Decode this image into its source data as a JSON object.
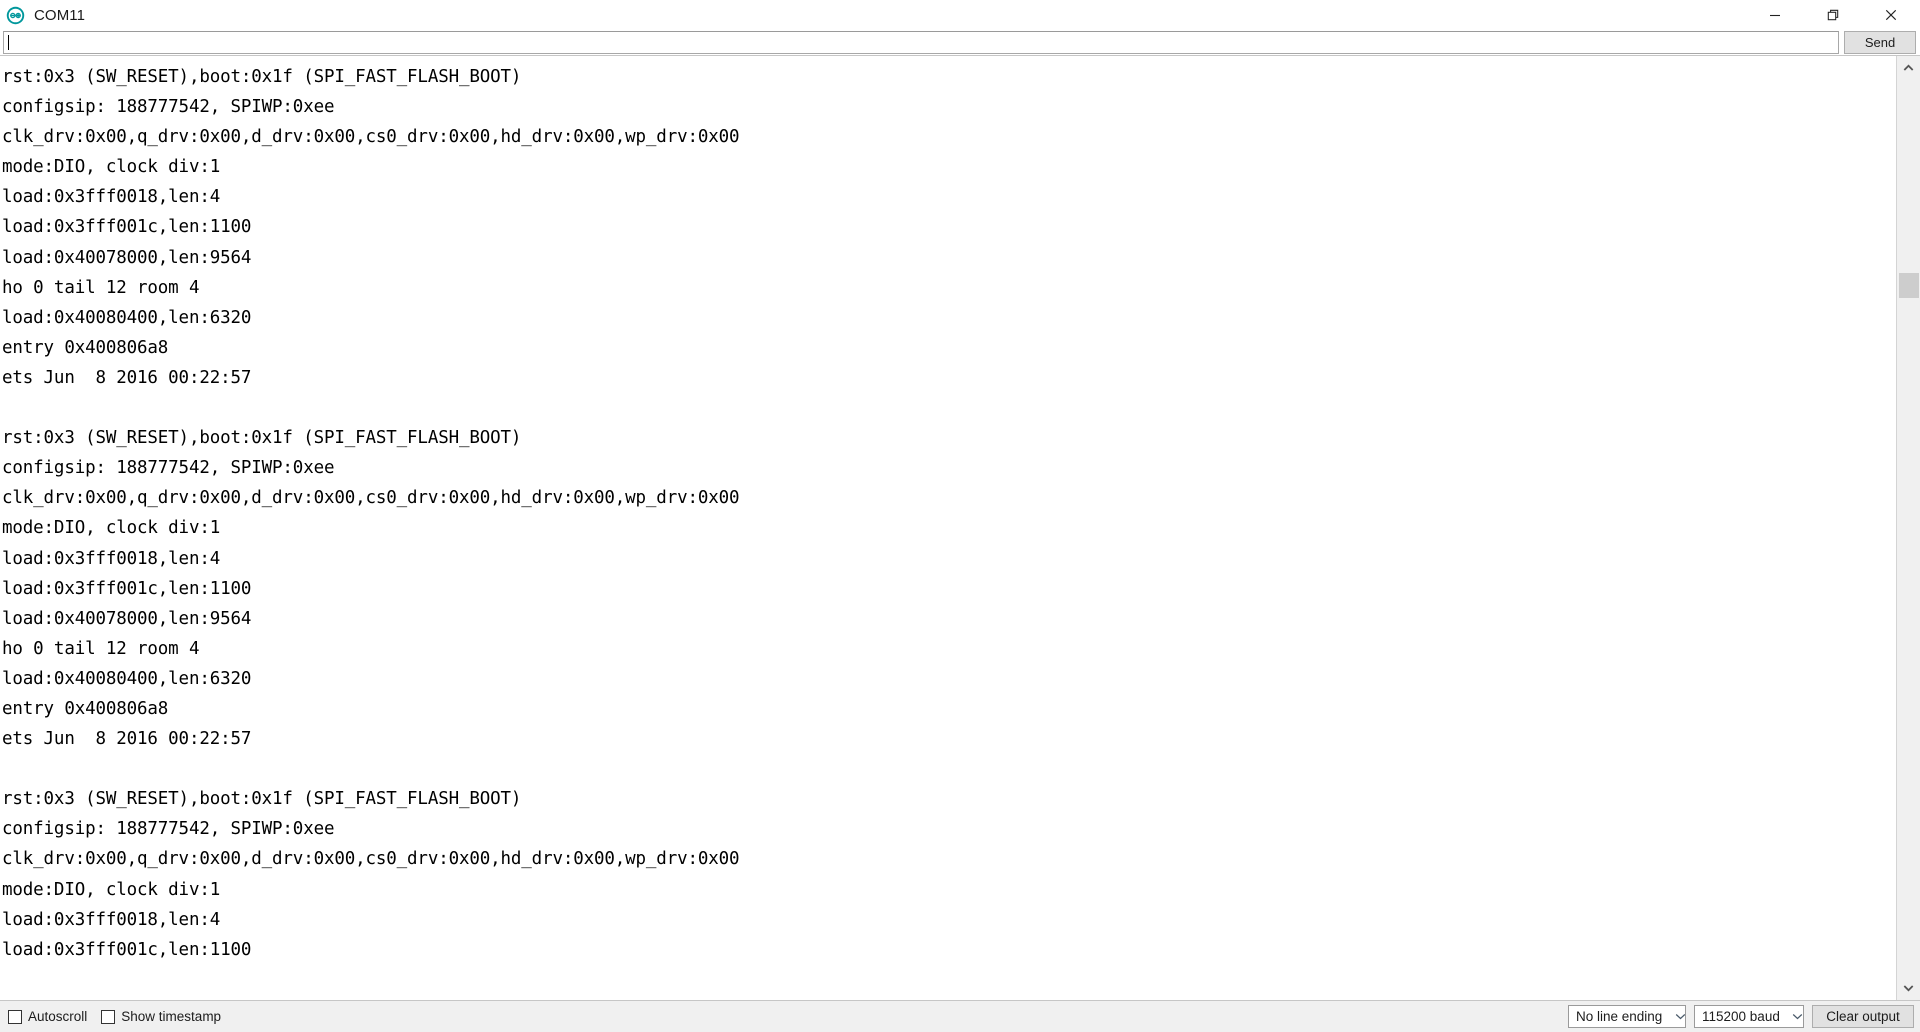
{
  "window": {
    "title": "COM11",
    "app_icon": "arduino-logo-icon",
    "controls": {
      "minimize_label": "Minimize",
      "restore_label": "Restore",
      "close_label": "Close"
    }
  },
  "send_bar": {
    "input_value": "",
    "input_placeholder": "",
    "send_label": "Send"
  },
  "console": {
    "lines": [
      "rst:0x3 (SW_RESET),boot:0x1f (SPI_FAST_FLASH_BOOT)",
      "configsip: 188777542, SPIWP:0xee",
      "clk_drv:0x00,q_drv:0x00,d_drv:0x00,cs0_drv:0x00,hd_drv:0x00,wp_drv:0x00",
      "mode:DIO, clock div:1",
      "load:0x3fff0018,len:4",
      "load:0x3fff001c,len:1100",
      "load:0x40078000,len:9564",
      "ho 0 tail 12 room 4",
      "load:0x40080400,len:6320",
      "entry 0x400806a8",
      "ets Jun  8 2016 00:22:57",
      "",
      "rst:0x3 (SW_RESET),boot:0x1f (SPI_FAST_FLASH_BOOT)",
      "configsip: 188777542, SPIWP:0xee",
      "clk_drv:0x00,q_drv:0x00,d_drv:0x00,cs0_drv:0x00,hd_drv:0x00,wp_drv:0x00",
      "mode:DIO, clock div:1",
      "load:0x3fff0018,len:4",
      "load:0x3fff001c,len:1100",
      "load:0x40078000,len:9564",
      "ho 0 tail 12 room 4",
      "load:0x40080400,len:6320",
      "entry 0x400806a8",
      "ets Jun  8 2016 00:22:57",
      "",
      "rst:0x3 (SW_RESET),boot:0x1f (SPI_FAST_FLASH_BOOT)",
      "configsip: 188777542, SPIWP:0xee",
      "clk_drv:0x00,q_drv:0x00,d_drv:0x00,cs0_drv:0x00,hd_drv:0x00,wp_drv:0x00",
      "mode:DIO, clock div:1",
      "load:0x3fff0018,len:4",
      "load:0x3fff001c,len:1100"
    ]
  },
  "scrollbar": {
    "up_arrow": "chevron-up-icon",
    "down_arrow": "chevron-down-icon",
    "thumb_top_pct": 21.5,
    "thumb_height_pct": 2.8
  },
  "statusbar": {
    "autoscroll": {
      "label": "Autoscroll",
      "checked": false
    },
    "show_timestamp": {
      "label": "Show timestamp",
      "checked": false
    },
    "line_ending": {
      "value": "No line ending"
    },
    "baud_rate": {
      "value": "115200 baud"
    },
    "clear_output_label": "Clear output"
  },
  "colors": {
    "brand_teal": "#00979c",
    "console_bg": "#ffffff",
    "console_text": "#000000",
    "statusbar_bg": "#f0f0f0",
    "button_face": "#e1e1e1",
    "scroll_thumb": "#cdcdcd"
  }
}
